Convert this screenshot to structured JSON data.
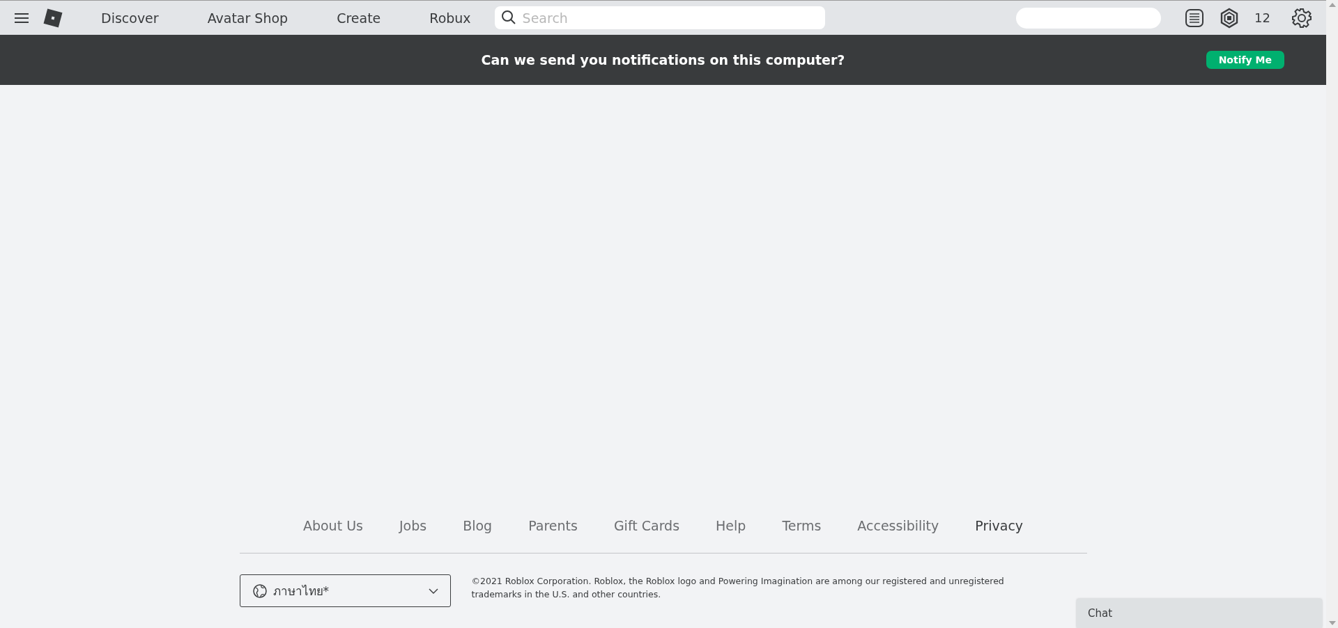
{
  "nav": {
    "items": [
      "Discover",
      "Avatar Shop",
      "Create",
      "Robux"
    ],
    "search": {
      "placeholder": "Search"
    },
    "robux_count": "12"
  },
  "banner": {
    "text": "Can we send you notifications on this computer?",
    "button": "Notify Me"
  },
  "footer": {
    "links": [
      {
        "label": "About Us",
        "emphasized": false
      },
      {
        "label": "Jobs",
        "emphasized": false
      },
      {
        "label": "Blog",
        "emphasized": false
      },
      {
        "label": "Parents",
        "emphasized": false
      },
      {
        "label": "Gift Cards",
        "emphasized": false
      },
      {
        "label": "Help",
        "emphasized": false
      },
      {
        "label": "Terms",
        "emphasized": false
      },
      {
        "label": "Accessibility",
        "emphasized": false
      },
      {
        "label": "Privacy",
        "emphasized": true
      }
    ],
    "language": "ภาษาไทย*",
    "copyright": "©2021 Roblox Corporation. Roblox, the Roblox logo and Powering Imagination are among our registered and unregistered trademarks in the U.S. and other countries."
  },
  "chat": {
    "title": "Chat"
  }
}
